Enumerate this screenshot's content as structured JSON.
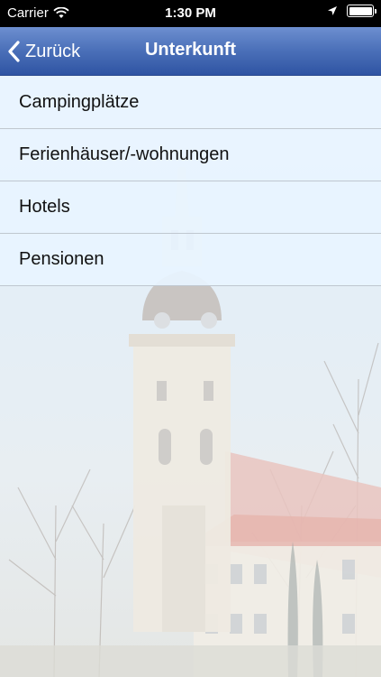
{
  "status_bar": {
    "carrier": "Carrier",
    "time": "1:30 PM"
  },
  "nav": {
    "back_label": "Zurück",
    "title": "Unterkunft"
  },
  "list": {
    "items": [
      {
        "label": "Campingplätze"
      },
      {
        "label": "Ferienhäuser/-wohnungen"
      },
      {
        "label": "Hotels"
      },
      {
        "label": "Pensionen"
      }
    ]
  },
  "colors": {
    "navbar_gradient_top": "#6d8fd0",
    "navbar_gradient_bottom": "#2f54a3",
    "list_item_background": "#e8f4ff"
  },
  "icons": {
    "back": "chevron-left-icon",
    "wifi": "wifi-icon",
    "location": "location-arrow-icon",
    "battery": "battery-icon"
  }
}
